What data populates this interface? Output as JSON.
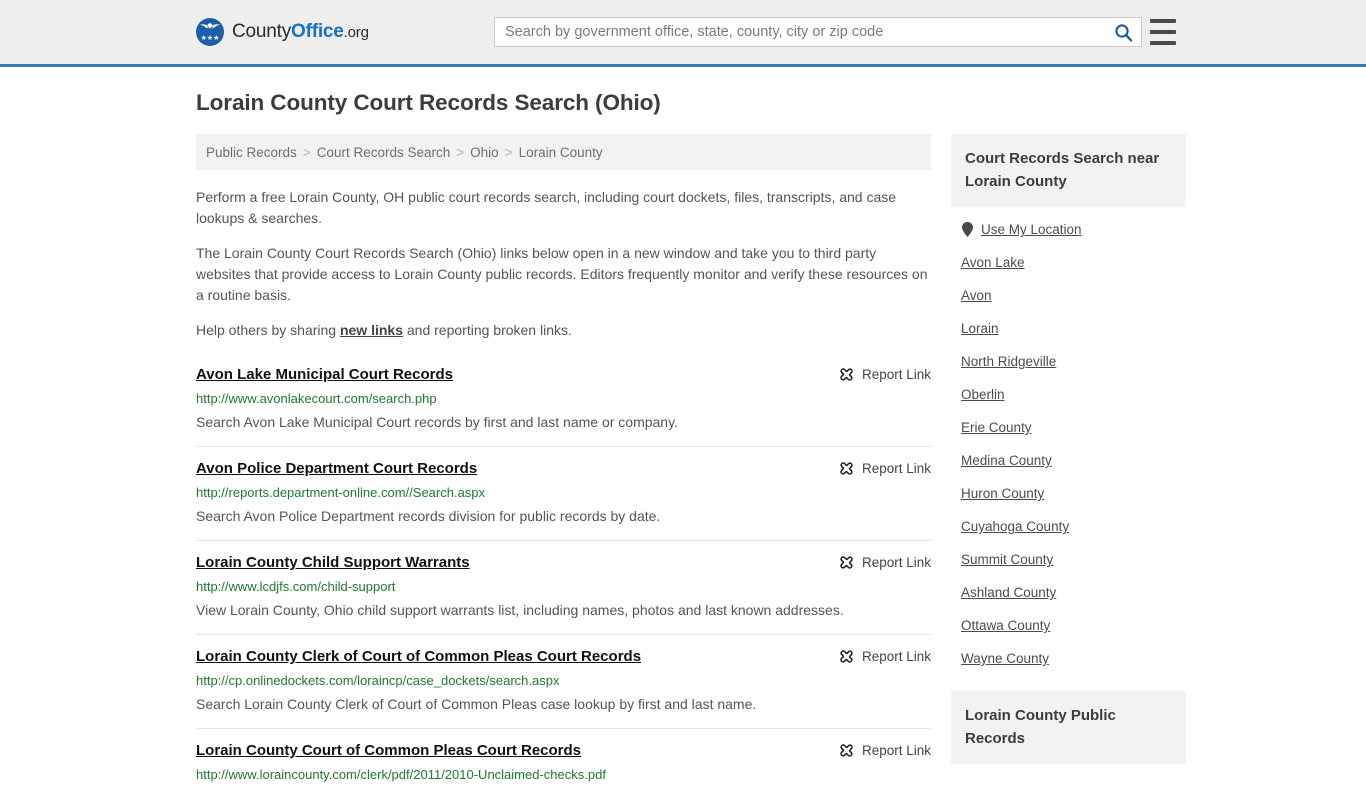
{
  "header": {
    "brand": {
      "part1": "County",
      "part2": "Office",
      "part3": ".org"
    },
    "search": {
      "placeholder": "Search by government office, state, county, city or zip code",
      "value": ""
    },
    "search_icon": "search-icon",
    "menu_icon": "hamburger-menu-icon"
  },
  "page_title": "Lorain County Court Records Search (Ohio)",
  "breadcrumb": {
    "separator": ">",
    "items": [
      {
        "label": "Public Records"
      },
      {
        "label": "Court Records Search"
      },
      {
        "label": "Ohio"
      },
      {
        "label": "Lorain County"
      }
    ]
  },
  "intro": {
    "p1": "Perform a free Lorain County, OH public court records search, including court dockets, files, transcripts, and case lookups & searches.",
    "p2": "The Lorain County Court Records Search (Ohio) links below open in a new window and take you to third party websites that provide access to Lorain County public records. Editors frequently monitor and verify these resources on a routine basis.",
    "p3_before": "Help others by sharing ",
    "p3_link": "new links",
    "p3_after": " and reporting broken links."
  },
  "results": {
    "report_label": "Report Link",
    "report_icon": "broken-link-icon",
    "items": [
      {
        "title": "Avon Lake Municipal Court Records",
        "url": "http://www.avonlakecourt.com/search.php",
        "description": "Search Avon Lake Municipal Court records by first and last name or company."
      },
      {
        "title": "Avon Police Department Court Records",
        "url": "http://reports.department-online.com//Search.aspx",
        "description": "Search Avon Police Department records division for public records by date."
      },
      {
        "title": "Lorain County Child Support Warrants",
        "url": "http://www.lcdjfs.com/child-support",
        "description": "View Lorain County, Ohio child support warrants list, including names, photos and last known addresses."
      },
      {
        "title": "Lorain County Clerk of Court of Common Pleas Court Records",
        "url": "http://cp.onlinedockets.com/loraincp/case_dockets/search.aspx",
        "description": "Search Lorain County Clerk of Court of Common Pleas case lookup by first and last name."
      },
      {
        "title": "Lorain County Court of Common Pleas Court Records",
        "url": "http://www.loraincounty.com/clerk/pdf/2011/2010-Unclaimed-checks.pdf",
        "description": ""
      }
    ]
  },
  "sidebar": {
    "nearby_heading": "Court Records Search near Lorain County",
    "public_records_heading": "Lorain County Public Records",
    "use_my_location": {
      "label": "Use My Location",
      "icon": "location-pin-icon"
    },
    "places": [
      {
        "label": "Avon Lake"
      },
      {
        "label": "Avon"
      },
      {
        "label": "Lorain"
      },
      {
        "label": "North Ridgeville"
      },
      {
        "label": "Oberlin"
      },
      {
        "label": "Erie County"
      },
      {
        "label": "Medina County"
      },
      {
        "label": "Huron County"
      },
      {
        "label": "Cuyahoga County"
      },
      {
        "label": "Summit County"
      },
      {
        "label": "Ashland County"
      },
      {
        "label": "Ottawa County"
      },
      {
        "label": "Wayne County"
      }
    ]
  },
  "colors": {
    "header_bg": "#eeeeec",
    "header_rule": "#3a79ac",
    "brand_blue": "#1b6fc4",
    "url_green": "#1e7a2e",
    "panel_gray": "#f2f2f2"
  }
}
